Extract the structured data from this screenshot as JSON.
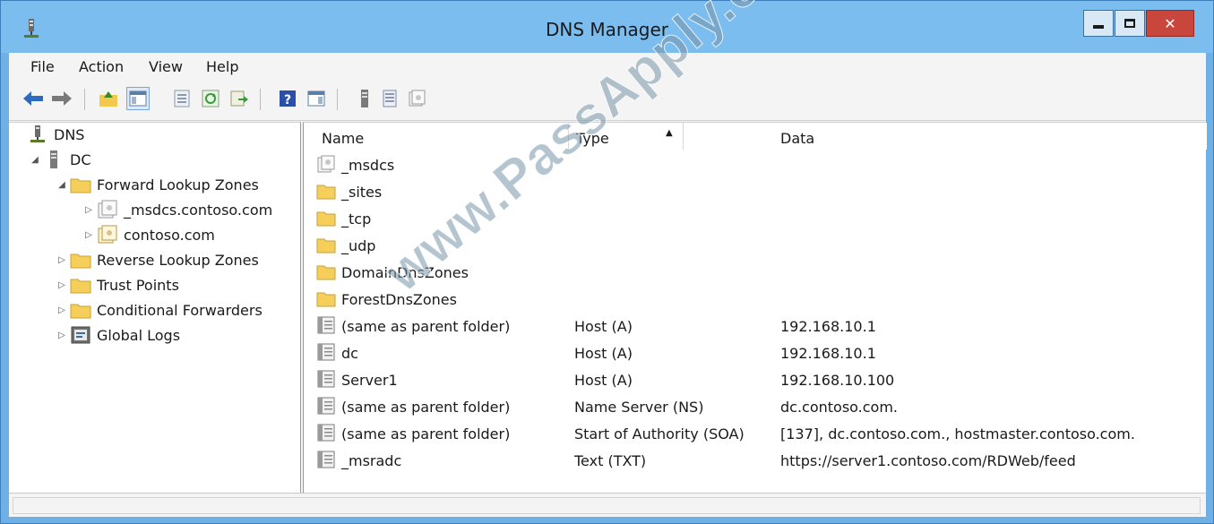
{
  "window": {
    "title": "DNS Manager"
  },
  "menu": [
    "File",
    "Action",
    "View",
    "Help"
  ],
  "toolbar": {
    "buttons": [
      "back-icon",
      "forward-icon",
      "up-folder-icon",
      "show-hide-tree-icon",
      "properties-icon",
      "refresh-icon",
      "export-list-icon",
      "help-icon",
      "action-pane-icon",
      "server-icon",
      "list-icon",
      "zone-icon"
    ]
  },
  "tree": {
    "root": "DNS",
    "server": "DC",
    "forward_zones": "Forward Lookup Zones",
    "zone_msdcs": "_msdcs.contoso.com",
    "zone_contoso": "contoso.com",
    "reverse_zones": "Reverse Lookup Zones",
    "trust_points": "Trust Points",
    "conditional_forwarders": "Conditional Forwarders",
    "global_logs": "Global Logs"
  },
  "columns": {
    "name": "Name",
    "type": "Type",
    "data": "Data"
  },
  "records": [
    {
      "name": "_msdcs",
      "type": "",
      "data": "",
      "icon": "delegated-zone-icon"
    },
    {
      "name": "_sites",
      "type": "",
      "data": "",
      "icon": "folder-icon"
    },
    {
      "name": "_tcp",
      "type": "",
      "data": "",
      "icon": "folder-icon"
    },
    {
      "name": "_udp",
      "type": "",
      "data": "",
      "icon": "folder-icon"
    },
    {
      "name": "DomainDnsZones",
      "type": "",
      "data": "",
      "icon": "folder-icon"
    },
    {
      "name": "ForestDnsZones",
      "type": "",
      "data": "",
      "icon": "folder-icon"
    },
    {
      "name": "(same as parent folder)",
      "type": "Host (A)",
      "data": "192.168.10.1",
      "icon": "record-icon"
    },
    {
      "name": "dc",
      "type": "Host (A)",
      "data": "192.168.10.1",
      "icon": "record-icon"
    },
    {
      "name": "Server1",
      "type": "Host (A)",
      "data": "192.168.10.100",
      "icon": "record-icon"
    },
    {
      "name": "(same as parent folder)",
      "type": "Name Server (NS)",
      "data": "dc.contoso.com.",
      "icon": "record-icon"
    },
    {
      "name": "(same as parent folder)",
      "type": "Start of Authority (SOA)",
      "data": "[137], dc.contoso.com., hostmaster.contoso.com.",
      "icon": "record-icon"
    },
    {
      "name": "_msradc",
      "type": "Text (TXT)",
      "data": "https://server1.contoso.com/RDWeb/feed",
      "icon": "record-icon"
    }
  ],
  "watermark": "www.PassApply.com",
  "colors": {
    "titlebar": "#7cbdf0",
    "close": "#c9463d",
    "folder": "#f5cf5a"
  }
}
